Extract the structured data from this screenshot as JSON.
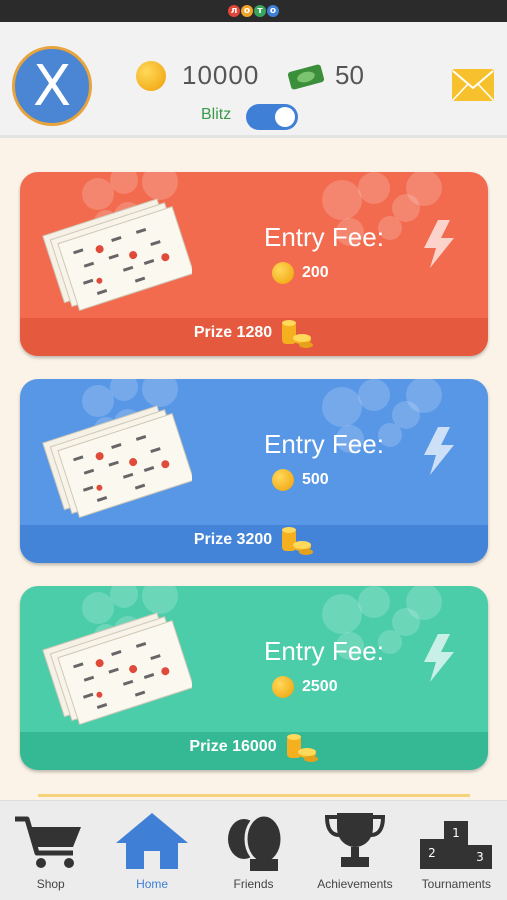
{
  "app": {
    "logo_letters": [
      "л",
      "о",
      "т",
      "о"
    ],
    "logo_colors": [
      "#e0463a",
      "#f2a32a",
      "#3aa55c",
      "#3f7fd6"
    ]
  },
  "header": {
    "avatar_letter": "X",
    "coins": "10000",
    "cash": "50",
    "blitz_label": "Blitz",
    "blitz_on": true
  },
  "games": [
    {
      "entry_label": "Entry Fee:",
      "fee": "200",
      "prize": "Prize 1280",
      "color": "#f26b4f"
    },
    {
      "entry_label": "Entry Fee:",
      "fee": "500",
      "prize": "Prize 3200",
      "color": "#5797e6"
    },
    {
      "entry_label": "Entry Fee:",
      "fee": "2500",
      "prize": "Prize 16000",
      "color": "#4ccdaa"
    }
  ],
  "nav": {
    "items": [
      {
        "label": "Shop",
        "icon": "cart-icon"
      },
      {
        "label": "Home",
        "icon": "home-icon",
        "active": true
      },
      {
        "label": "Friends",
        "icon": "friends-icon"
      },
      {
        "label": "Achievements",
        "icon": "trophy-icon"
      },
      {
        "label": "Tournaments",
        "icon": "podium-icon"
      }
    ]
  }
}
